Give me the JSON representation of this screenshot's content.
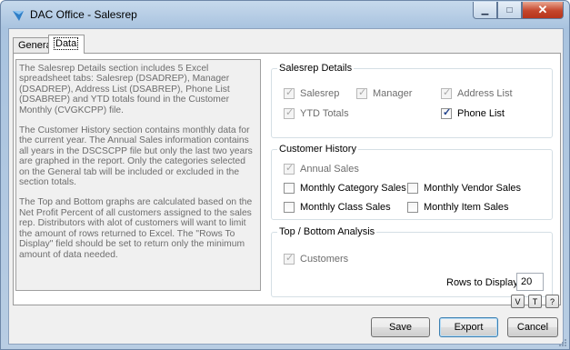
{
  "window": {
    "title": "DAC Office - Salesrep",
    "minimize_glyph": "▁",
    "maximize_glyph": "□",
    "close_glyph": "✕"
  },
  "tabs": [
    {
      "label": "General"
    },
    {
      "label": "Data"
    }
  ],
  "info": {
    "paragraphs": [
      "The Salesrep Details section includes 5 Excel spreadsheet tabs: Salesrep (DSADREP), Manager (DSADREP), Address List (DSABREP), Phone List (DSABREP) and YTD totals found in the Customer Monthly (CVGKCPP) file.",
      "The Customer History section contains monthly data for the current year.  The Annual Sales information contains all years in the DSCSCPP file but only the last two years are graphed in the report.  Only the categories selected on the General tab will be included or excluded in the section totals.",
      "The Top and Bottom graphs are calculated based on the Net Profit Percent of all customers assigned to the sales rep. Distributors with alot of customers will want to limit the amount of rows returned to Excel.  The \"Rows To Display\" field should be set to return only the minimum amount of data needed."
    ]
  },
  "salesrep_details": {
    "title": "Salesrep Details",
    "salesrep": "Salesrep",
    "manager": "Manager",
    "address_list": "Address List",
    "ytd_totals": "YTD Totals",
    "phone_list": "Phone List"
  },
  "customer_history": {
    "title": "Customer History",
    "annual_sales": "Annual Sales",
    "monthly_category_sales": "Monthly Category Sales",
    "monthly_vendor_sales": "Monthly Vendor Sales",
    "monthly_class_sales": "Monthly Class Sales",
    "monthly_item_sales": "Monthly Item Sales"
  },
  "top_bottom": {
    "title": "Top / Bottom Analysis",
    "customers": "Customers",
    "rows_label": "Rows to Display",
    "rows_value": "20"
  },
  "mini_buttons": [
    "V",
    "T",
    "?"
  ],
  "buttons": {
    "save": "Save",
    "export": "Export",
    "cancel": "Cancel"
  },
  "check_glyph": "✓",
  "colors": {
    "accent": "#3c7fb1",
    "close_red": "#c4452b"
  }
}
